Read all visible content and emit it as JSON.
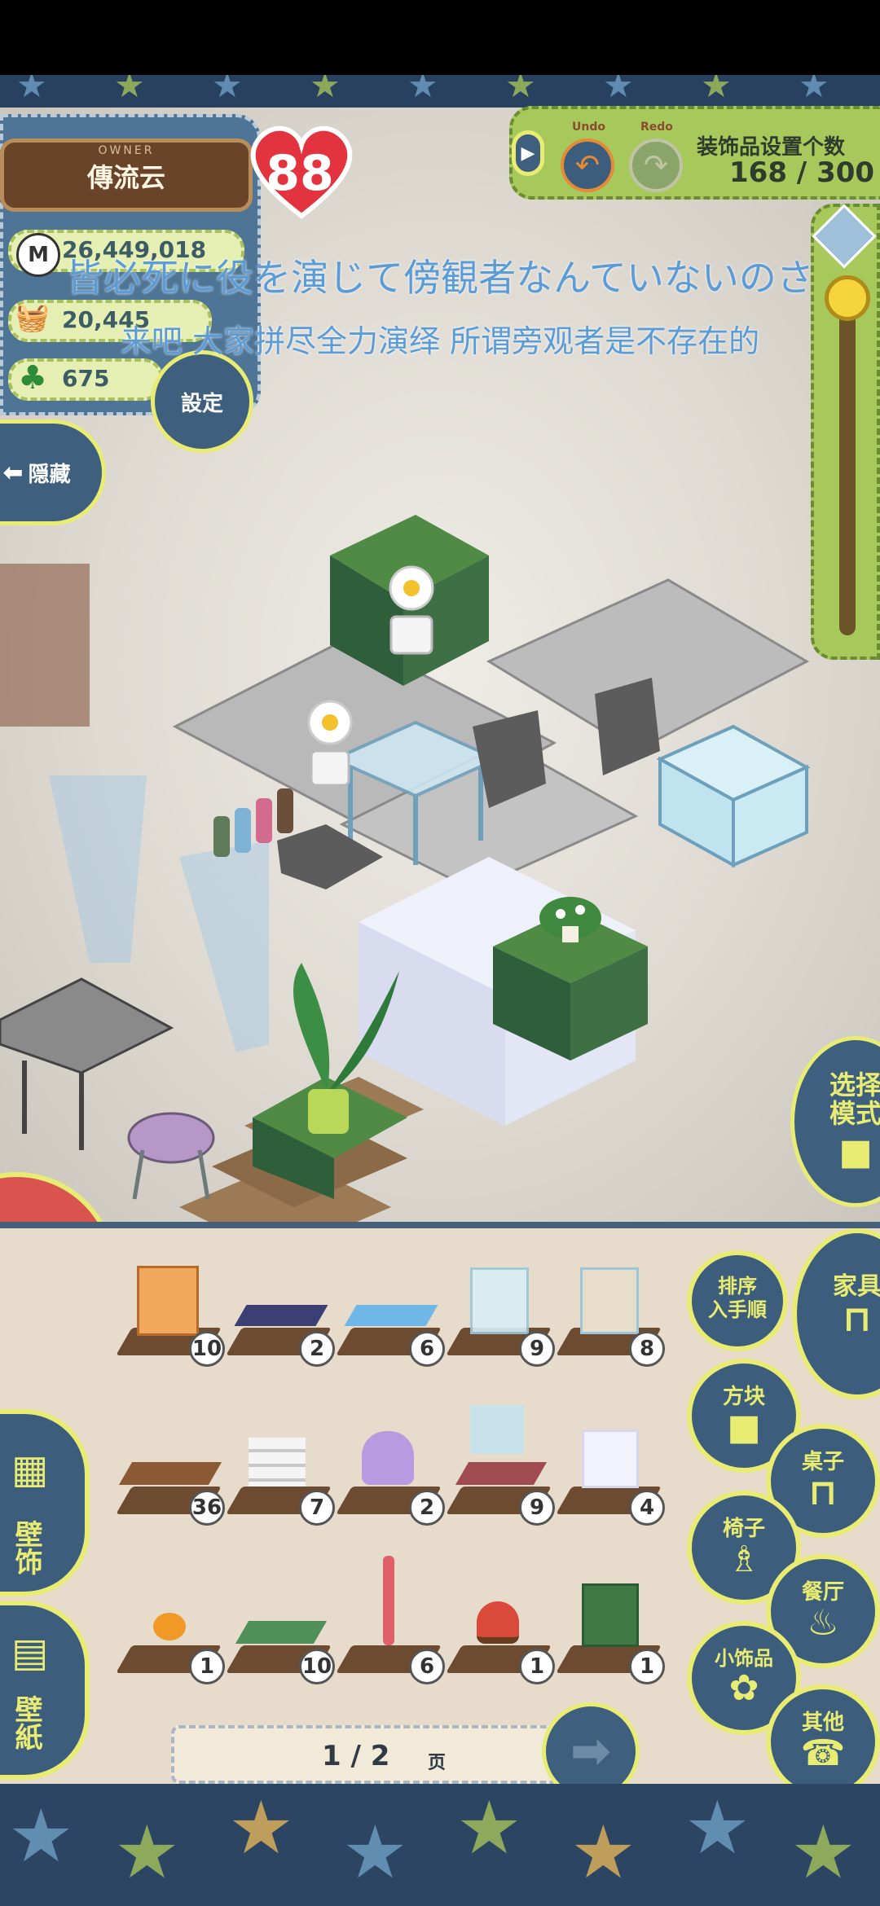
{
  "owner": {
    "label": "OWNER",
    "name": "傳流云",
    "level": "88"
  },
  "stats": {
    "money": "26,449,018",
    "items": "20,445",
    "clover": "675"
  },
  "buttons": {
    "settings": "設定",
    "hide": "隠藏",
    "select_mode": "选择\n模式",
    "undo_label": "Undo",
    "redo_label": "Redo"
  },
  "decoration_count": {
    "label": "装饰品设置个数",
    "value": "168 / 300"
  },
  "subtitles": {
    "jp": "皆必死に役を演じて傍観者なんていないのさ",
    "cn": "来吧 大家拼尽全力演绎 所谓旁观者是不存在的"
  },
  "inventory": {
    "counts_row1": [
      "10",
      "2",
      "6",
      "9",
      "8"
    ],
    "counts_row2": [
      "36",
      "7",
      "2",
      "9",
      "4"
    ],
    "counts_row3": [
      "1",
      "10",
      "6",
      "1",
      "1"
    ],
    "page": "1 / 2",
    "page_unit": "页"
  },
  "categories": {
    "sort": "排序\n入手順",
    "furniture": "家具",
    "block": "方块",
    "table": "桌子",
    "chair": "椅子",
    "restaurant": "餐厅",
    "small": "小饰品",
    "other": "其他",
    "wall": "壁饰",
    "wallpaper": "壁紙"
  },
  "colors": {
    "panel_blue": "#3d5d7c",
    "accent_yellow": "#e9ec72",
    "panel_green": "#a7c95b",
    "heart_red": "#e2333f"
  }
}
